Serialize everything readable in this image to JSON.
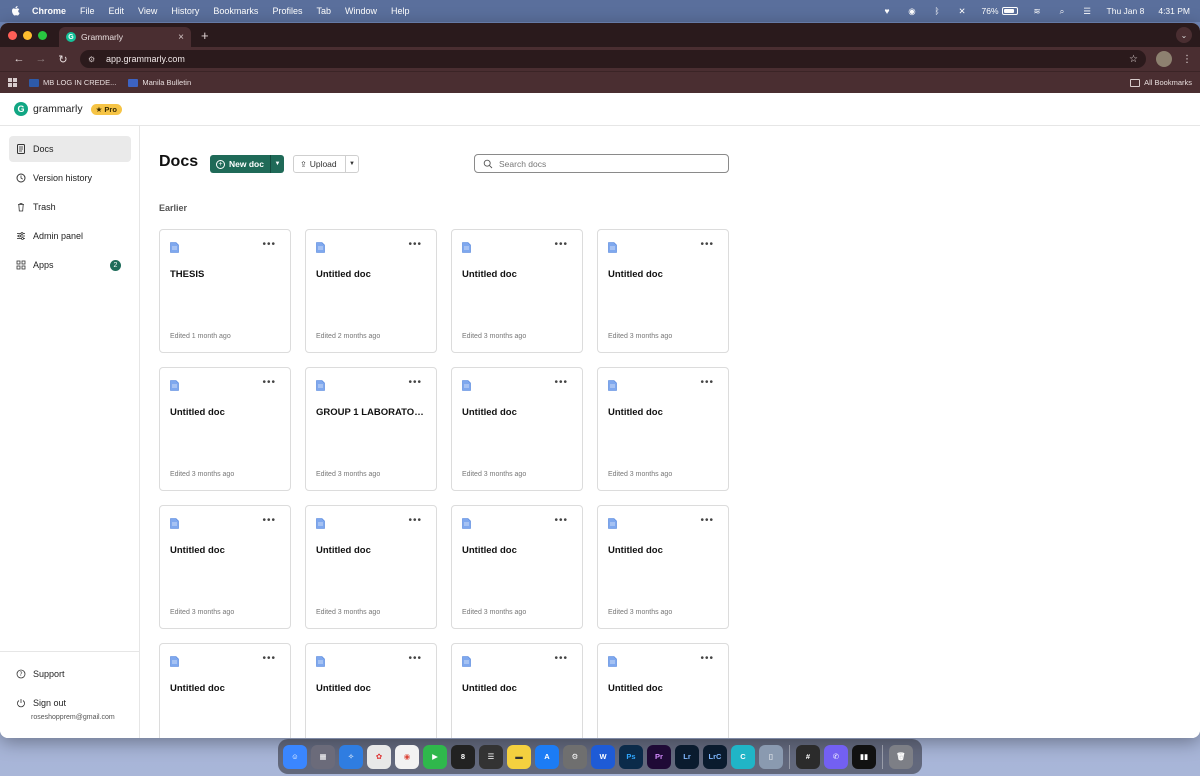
{
  "menubar": {
    "app": "Chrome",
    "items": [
      "File",
      "Edit",
      "View",
      "History",
      "Bookmarks",
      "Profiles",
      "Tab",
      "Window",
      "Help"
    ],
    "battery": "76%",
    "date": "Thu Jan 8",
    "time": "4:31 PM"
  },
  "browser": {
    "tab_title": "Grammarly",
    "url": "app.grammarly.com",
    "bookmarks": [
      "MB LOG IN CREDE...",
      "Manila Bulletin"
    ],
    "all_bookmarks": "All Bookmarks"
  },
  "app": {
    "brand": "grammarly",
    "pro_badge": "★ Pro",
    "sidebar": {
      "items": [
        {
          "label": "Docs",
          "icon": "doc-icon"
        },
        {
          "label": "Version history",
          "icon": "history-icon"
        },
        {
          "label": "Trash",
          "icon": "trash-icon"
        },
        {
          "label": "Admin panel",
          "icon": "sliders-icon"
        },
        {
          "label": "Apps",
          "icon": "apps-icon",
          "badge": "2"
        }
      ],
      "support": "Support",
      "sign_out": "Sign out",
      "email": "roseshopprem@gmail.com"
    },
    "main": {
      "title": "Docs",
      "new_doc": "New doc",
      "upload": "Upload",
      "search_placeholder": "Search docs",
      "section": "Earlier",
      "docs": [
        {
          "title": "THESIS",
          "edited": "Edited 1 month ago"
        },
        {
          "title": "Untitled doc",
          "edited": "Edited 2 months ago"
        },
        {
          "title": "Untitled doc",
          "edited": "Edited 3 months ago"
        },
        {
          "title": "Untitled doc",
          "edited": "Edited 3 months ago"
        },
        {
          "title": "Untitled doc",
          "edited": "Edited 3 months ago"
        },
        {
          "title": "GROUP 1 LABORATOR...",
          "edited": "Edited 3 months ago"
        },
        {
          "title": "Untitled doc",
          "edited": "Edited 3 months ago"
        },
        {
          "title": "Untitled doc",
          "edited": "Edited 3 months ago"
        },
        {
          "title": "Untitled doc",
          "edited": "Edited 3 months ago"
        },
        {
          "title": "Untitled doc",
          "edited": "Edited 3 months ago"
        },
        {
          "title": "Untitled doc",
          "edited": "Edited 3 months ago"
        },
        {
          "title": "Untitled doc",
          "edited": "Edited 3 months ago"
        },
        {
          "title": "Untitled doc",
          "edited": ""
        },
        {
          "title": "Untitled doc",
          "edited": ""
        },
        {
          "title": "Untitled doc",
          "edited": ""
        },
        {
          "title": "Untitled doc",
          "edited": ""
        }
      ]
    }
  },
  "colors": {
    "accent": "#1f6a58",
    "pro": "#f6c445",
    "browser_chrome": "#4a2e31"
  }
}
